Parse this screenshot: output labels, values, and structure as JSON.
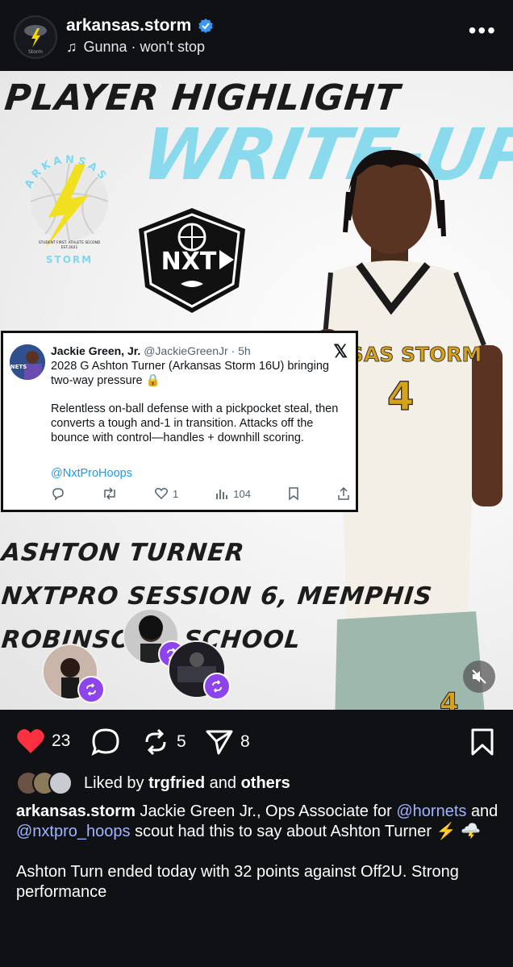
{
  "header": {
    "username": "arkansas.storm",
    "music": "Gunna · won't stop",
    "avatar_text": "Storm"
  },
  "post": {
    "title_line1": "PLAYER HIGHLIGHT",
    "title_line2": "WRITE-UP",
    "logo_top": "ARKANSAS",
    "logo_bottom": "STORM",
    "logo_small": "STUDENT FIRST. ATHLETE SECOND",
    "logo_est": "EST.2021",
    "nxt_text": "NXT",
    "tweet": {
      "name": "Jackie Green, Jr.",
      "handle": "@JackieGreenJr · 5h",
      "line1": "2028 G Ashton Turner (Arkansas Storm 16U) bringing two-way pressure 🔒",
      "line2": "Relentless on-ball defense with a pickpocket steal, then converts a tough and-1 in transition. Attacks off the bounce with control—handles + downhill scoring.",
      "mention": "@NxtProHoops",
      "likes": "1",
      "views": "104",
      "avatar_label": "NETS"
    },
    "player_name": "ASHTON TURNER",
    "event": "NXTPRO SESSION 6, MEMPHIS",
    "school_left": "ROBINSON",
    "school_right": "SCHOOL",
    "jersey_text": "ANSAS STORM",
    "jersey_number": "4"
  },
  "actions": {
    "likes": "23",
    "reposts": "5",
    "shares": "8"
  },
  "liked_by": {
    "prefix": "Liked by",
    "user": "trgfried",
    "and": "and",
    "others": "others"
  },
  "caption": {
    "username": "arkansas.storm",
    "text1": "Jackie Green Jr., Ops Associate for",
    "mention1": "@hornets",
    "and": "and",
    "mention2": "@nxtpro_hoops",
    "text2": "scout had this to say about Ashton Turner ⚡ 🌩️",
    "para2": "Ashton Turn ended today with 32 points against Off2U. Strong performance"
  },
  "colors": {
    "background": "#0f1114",
    "accent_cyan": "#7fd8ee",
    "like_red": "#ff3040",
    "link": "#a0b4ff",
    "repost_purple": "#8e44ec"
  }
}
